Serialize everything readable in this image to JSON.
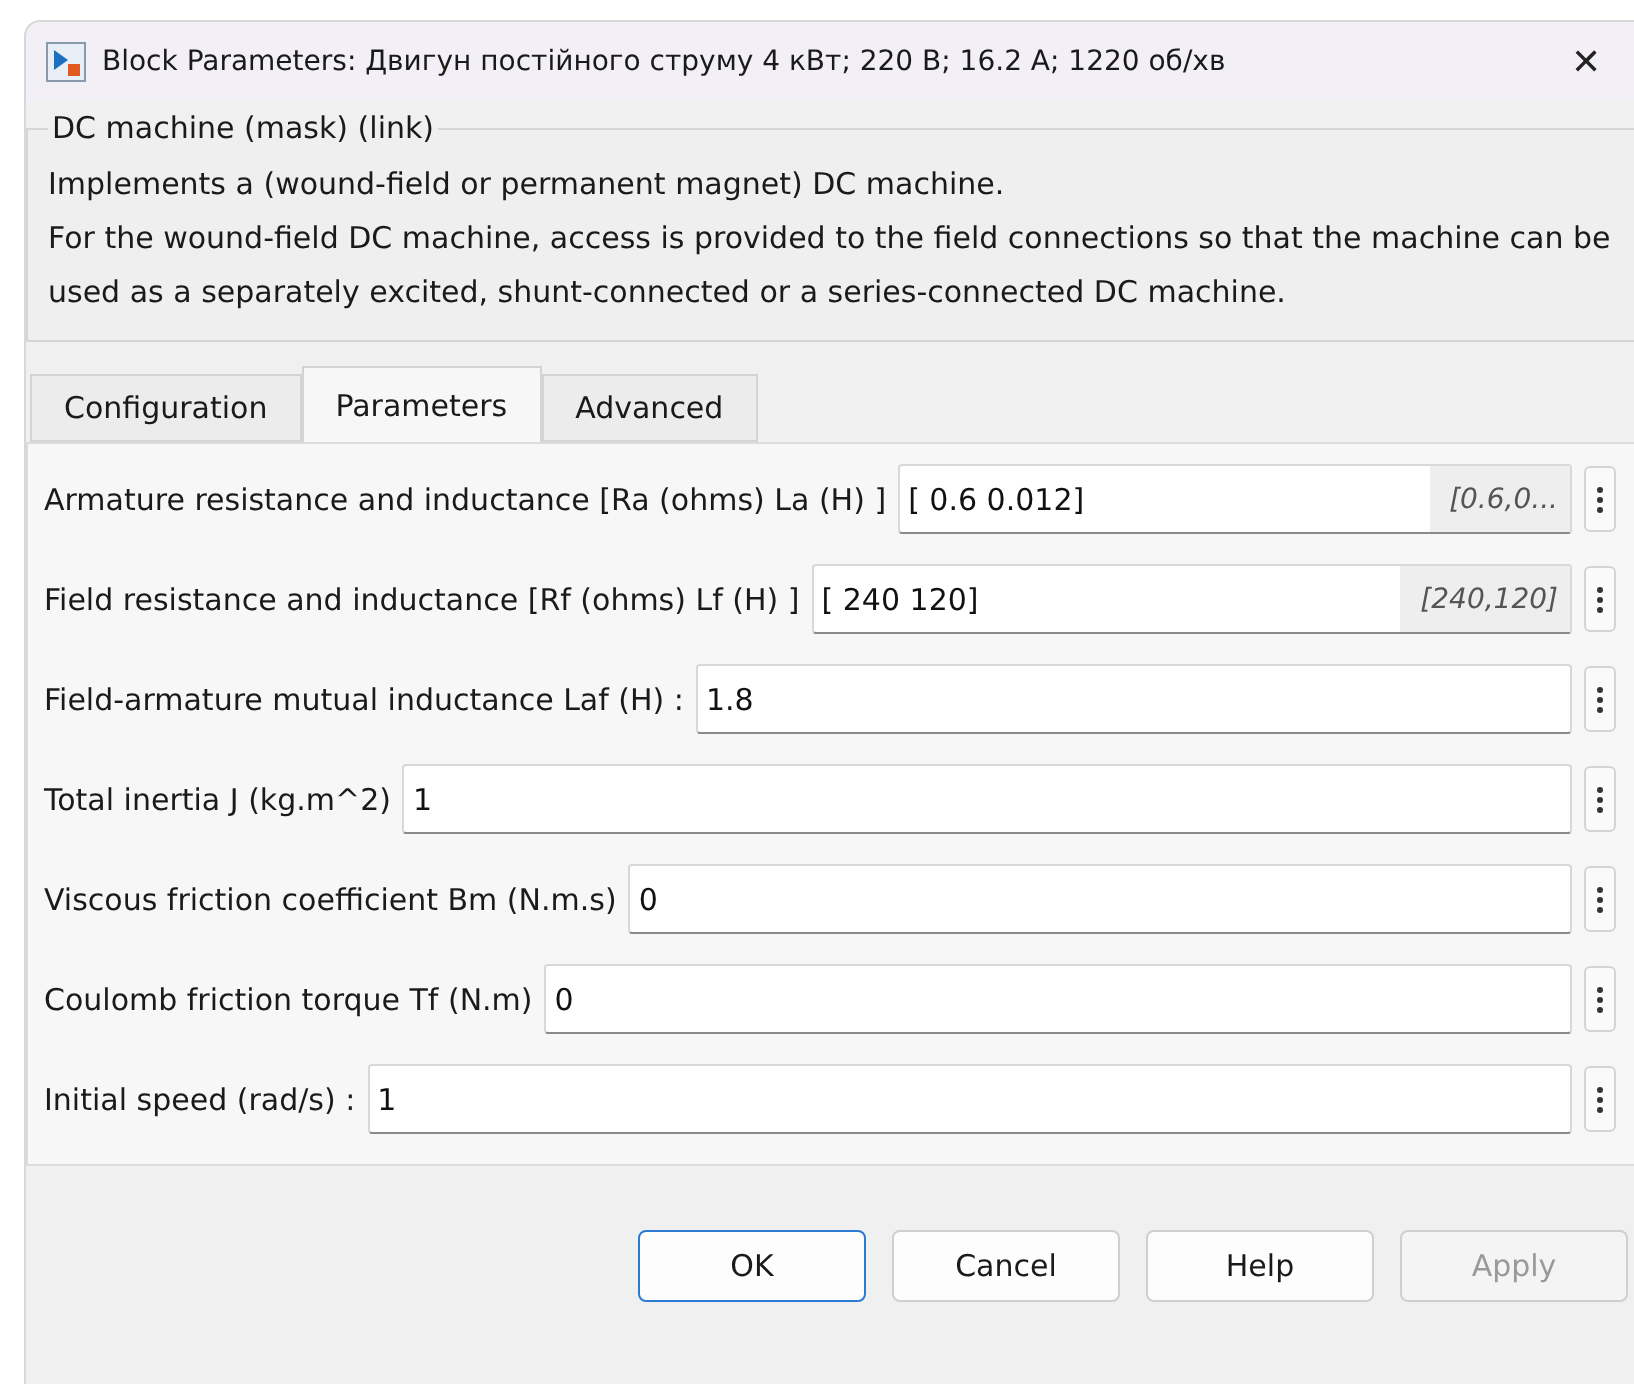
{
  "window": {
    "title": "Block Parameters: Двигун постійного струму 4 кВт; 220 В; 16.2 А; 1220 об/хв",
    "close": "✕"
  },
  "group": {
    "legend": "DC machine (mask) (link)",
    "description": [
      "Implements a (wound-field or permanent magnet) DC machine.",
      "For the wound-field DC machine, access is provided to the field connections so that the machine can be used as a separately excited, shunt-connected or a series-connected  DC machine."
    ]
  },
  "tabs": [
    {
      "label": "Configuration",
      "selected": false
    },
    {
      "label": "Parameters",
      "selected": true
    },
    {
      "label": "Advanced",
      "selected": false
    }
  ],
  "parameters": [
    {
      "label": "Armature resistance and inductance [Ra (ohms) La (H) ]",
      "value": "[ 0.6  0.012]",
      "evaluated": "[0.6,0..."
    },
    {
      "label": "Field resistance and inductance [Rf (ohms) Lf (H) ]",
      "value": "[ 240  120]",
      "evaluated": "[240,120]"
    },
    {
      "label": "Field-armature mutual inductance Laf (H) :",
      "value": "1.8"
    },
    {
      "label": "Total inertia J (kg.m^2)",
      "value": "1"
    },
    {
      "label": "Viscous friction coefficient Bm (N.m.s)",
      "value": "0"
    },
    {
      "label": "Coulomb friction torque Tf (N.m)",
      "value": "0"
    },
    {
      "label": "Initial speed (rad/s) :",
      "value": "1"
    }
  ],
  "buttons": [
    {
      "label": "OK",
      "disabled": false,
      "default": true
    },
    {
      "label": "Cancel",
      "disabled": false,
      "default": false
    },
    {
      "label": "Help",
      "disabled": false,
      "default": false
    },
    {
      "label": "Apply",
      "disabled": true,
      "default": false
    }
  ]
}
